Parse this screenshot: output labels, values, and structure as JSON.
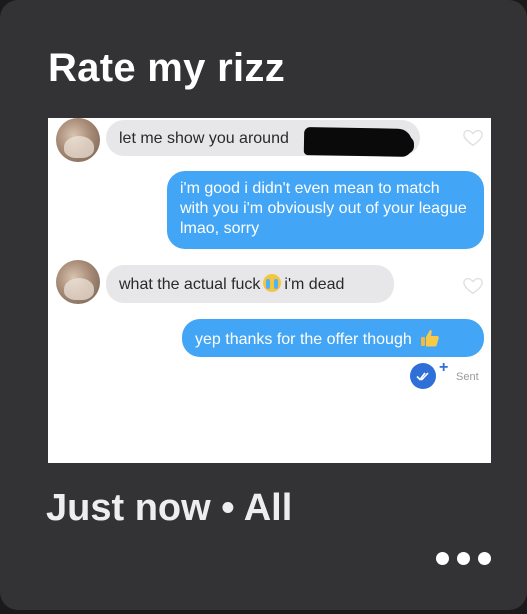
{
  "post": {
    "title": "Rate my rizz",
    "footer_time": "Just now",
    "footer_separator": "•",
    "footer_scope": "All"
  },
  "icons": {
    "more": "more-dots-icon",
    "heart": "heart-outline-icon",
    "sent": "double-check-icon",
    "emoji_crying": "loudly-crying-face-emoji",
    "emoji_thumb": "thumbs-up-emoji"
  },
  "colors": {
    "card_bg": "#333335",
    "outgoing_bubble": "#42a5f5",
    "incoming_bubble": "#e7e7ea",
    "sent_badge": "#2f6fd8"
  },
  "chat": {
    "messages": [
      {
        "from": "them",
        "text": "let me show you around"
      },
      {
        "from": "me",
        "text": "i'm good i didn't even mean to match with you i'm obviously out of your league lmao, sorry"
      },
      {
        "from": "them",
        "text_before": "what the actual fuck",
        "text_after": "i'm dead"
      },
      {
        "from": "me",
        "text": "yep thanks for the offer though"
      }
    ],
    "plus": "+",
    "sent_label": "Sent"
  }
}
